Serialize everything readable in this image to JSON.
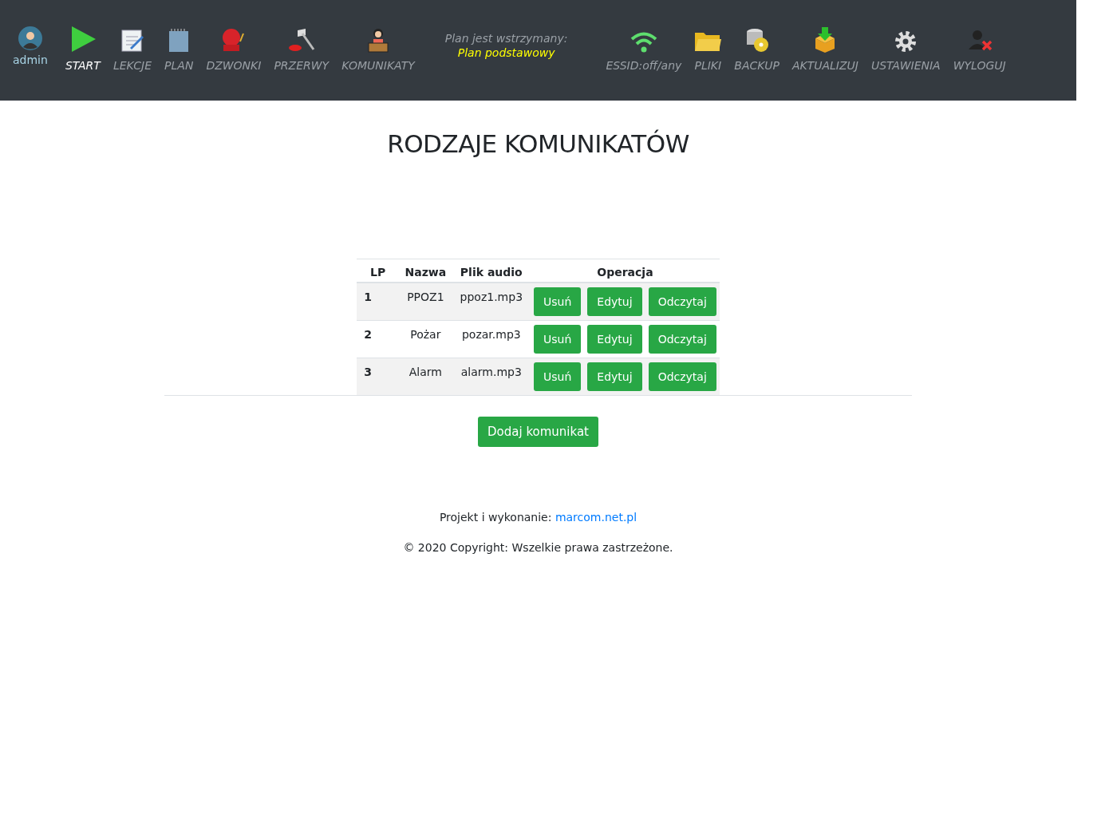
{
  "user": {
    "name": "admin"
  },
  "nav_left": [
    {
      "label": "START",
      "selected": true
    },
    {
      "label": "LEKCJE",
      "selected": false
    },
    {
      "label": "PLAN",
      "selected": false
    },
    {
      "label": "DZWONKI",
      "selected": false
    },
    {
      "label": "PRZERWY",
      "selected": false
    },
    {
      "label": "KOMUNIKATY",
      "selected": false
    }
  ],
  "status": {
    "line_1": "Plan jest wstrzymany:",
    "line_2": "Plan podstawowy"
  },
  "nav_right": [
    {
      "label": "ESSID:off/any",
      "selected": false
    },
    {
      "label": "PLIKI",
      "selected": false
    },
    {
      "label": "BACKUP",
      "selected": false
    },
    {
      "label": "AKTUALIZUJ",
      "selected": false
    },
    {
      "label": "USTAWIENIA",
      "selected": false
    },
    {
      "label": "WYLOGUJ",
      "selected": false
    }
  ],
  "page_title": "RODZAJE KOMUNIKATÓW",
  "table": {
    "columns": [
      "LP",
      "Nazwa",
      "Plik audio",
      "Operacja"
    ],
    "rows": [
      {
        "lp": "1",
        "name": "PPOZ1",
        "file": "ppoz1.mp3",
        "actions": [
          "Usuń",
          "Edytuj",
          "Odczytaj"
        ]
      },
      {
        "lp": "2",
        "name": "Pożar",
        "file": "pozar.mp3",
        "actions": [
          "Usuń",
          "Edytuj",
          "Odczytaj"
        ]
      },
      {
        "lp": "3",
        "name": "Alarm",
        "file": "alarm.mp3",
        "actions": [
          "Usuń",
          "Edytuj",
          "Odczytaj"
        ]
      }
    ]
  },
  "add_button": "Dodaj komunikat",
  "footer": {
    "credit_label": "Projekt i wykonanie:",
    "credit_link": "marcom.net.pl",
    "copyright": "© 2020 Copyright: Wszelkie prawa zastrzeżone."
  }
}
